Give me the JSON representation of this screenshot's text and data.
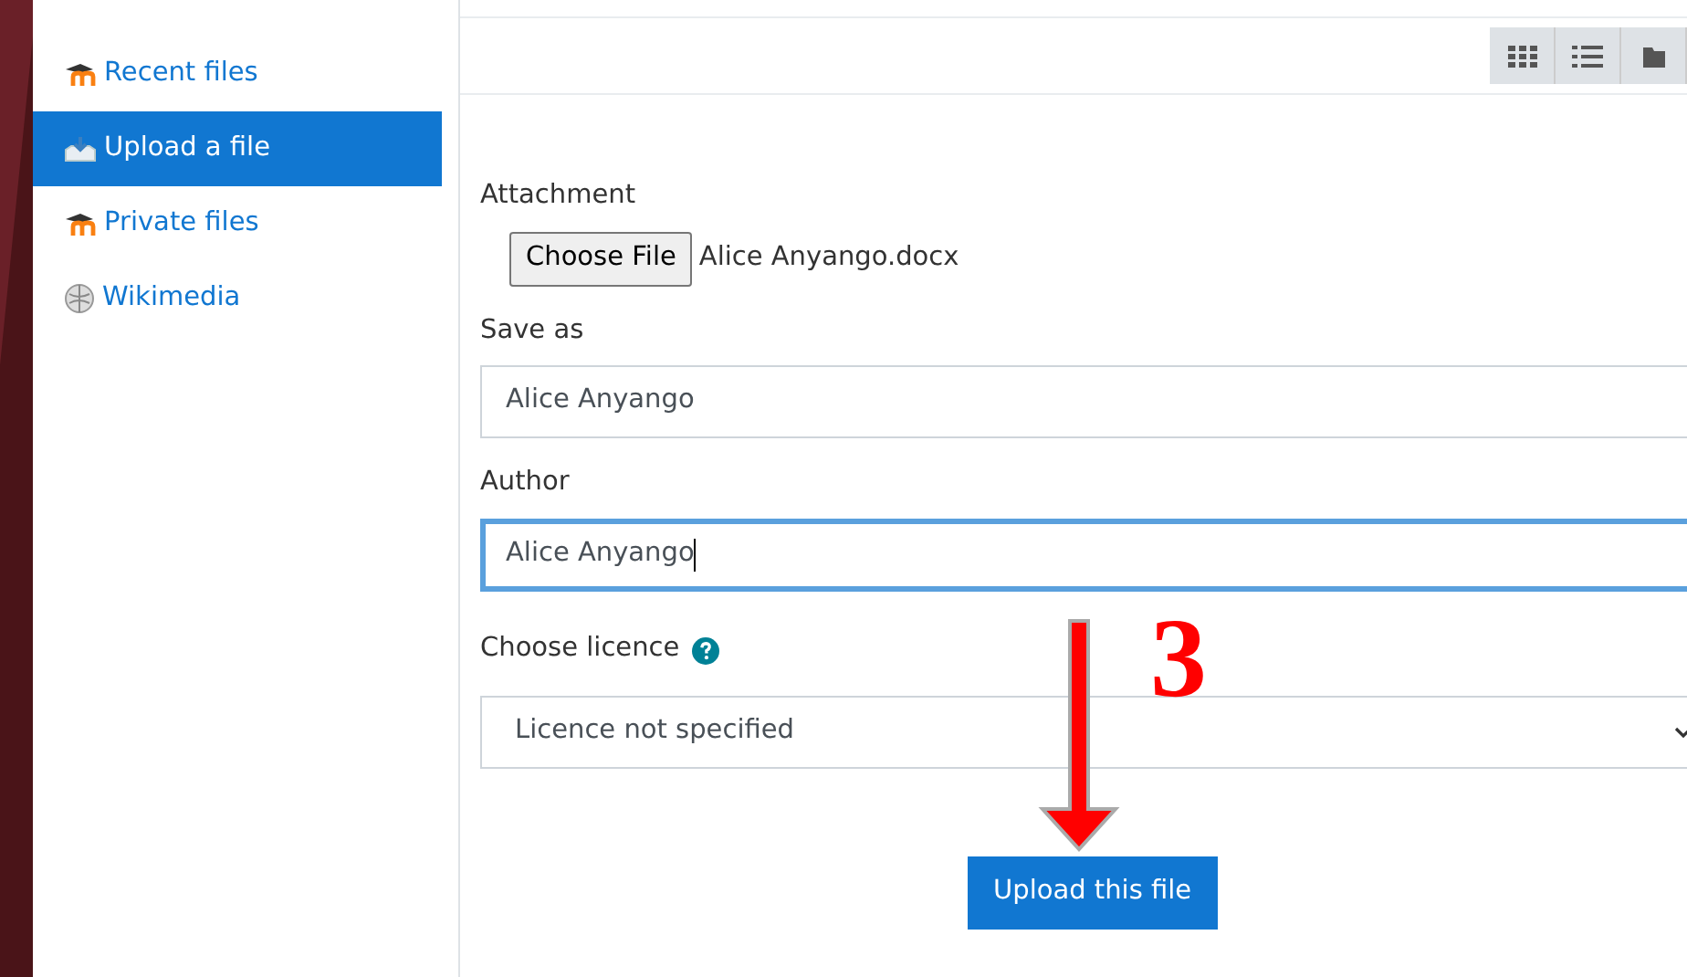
{
  "sidebar": {
    "items": [
      {
        "label": "Recent files",
        "kind": "moodle",
        "selected": false
      },
      {
        "label": "Upload a file",
        "kind": "upload",
        "selected": true
      },
      {
        "label": "Private files",
        "kind": "moodle",
        "selected": false
      },
      {
        "label": "Wikimedia",
        "kind": "wiki",
        "selected": false
      }
    ]
  },
  "toolbar": {
    "view_buttons": [
      {
        "kind": "icons"
      },
      {
        "kind": "list"
      },
      {
        "kind": "tree"
      }
    ]
  },
  "form": {
    "attachment": {
      "label": "Attachment",
      "button": "Choose File",
      "file_name": "Alice Anyango.docx"
    },
    "save_as": {
      "label": "Save as",
      "value": "Alice Anyango",
      "focused": false
    },
    "author": {
      "label": "Author",
      "value": "Alice Anyango",
      "focused": true
    },
    "licence": {
      "label": "Choose licence",
      "value": "Licence not specified"
    },
    "submit": "Upload this file"
  },
  "annotation": {
    "number": "3"
  }
}
